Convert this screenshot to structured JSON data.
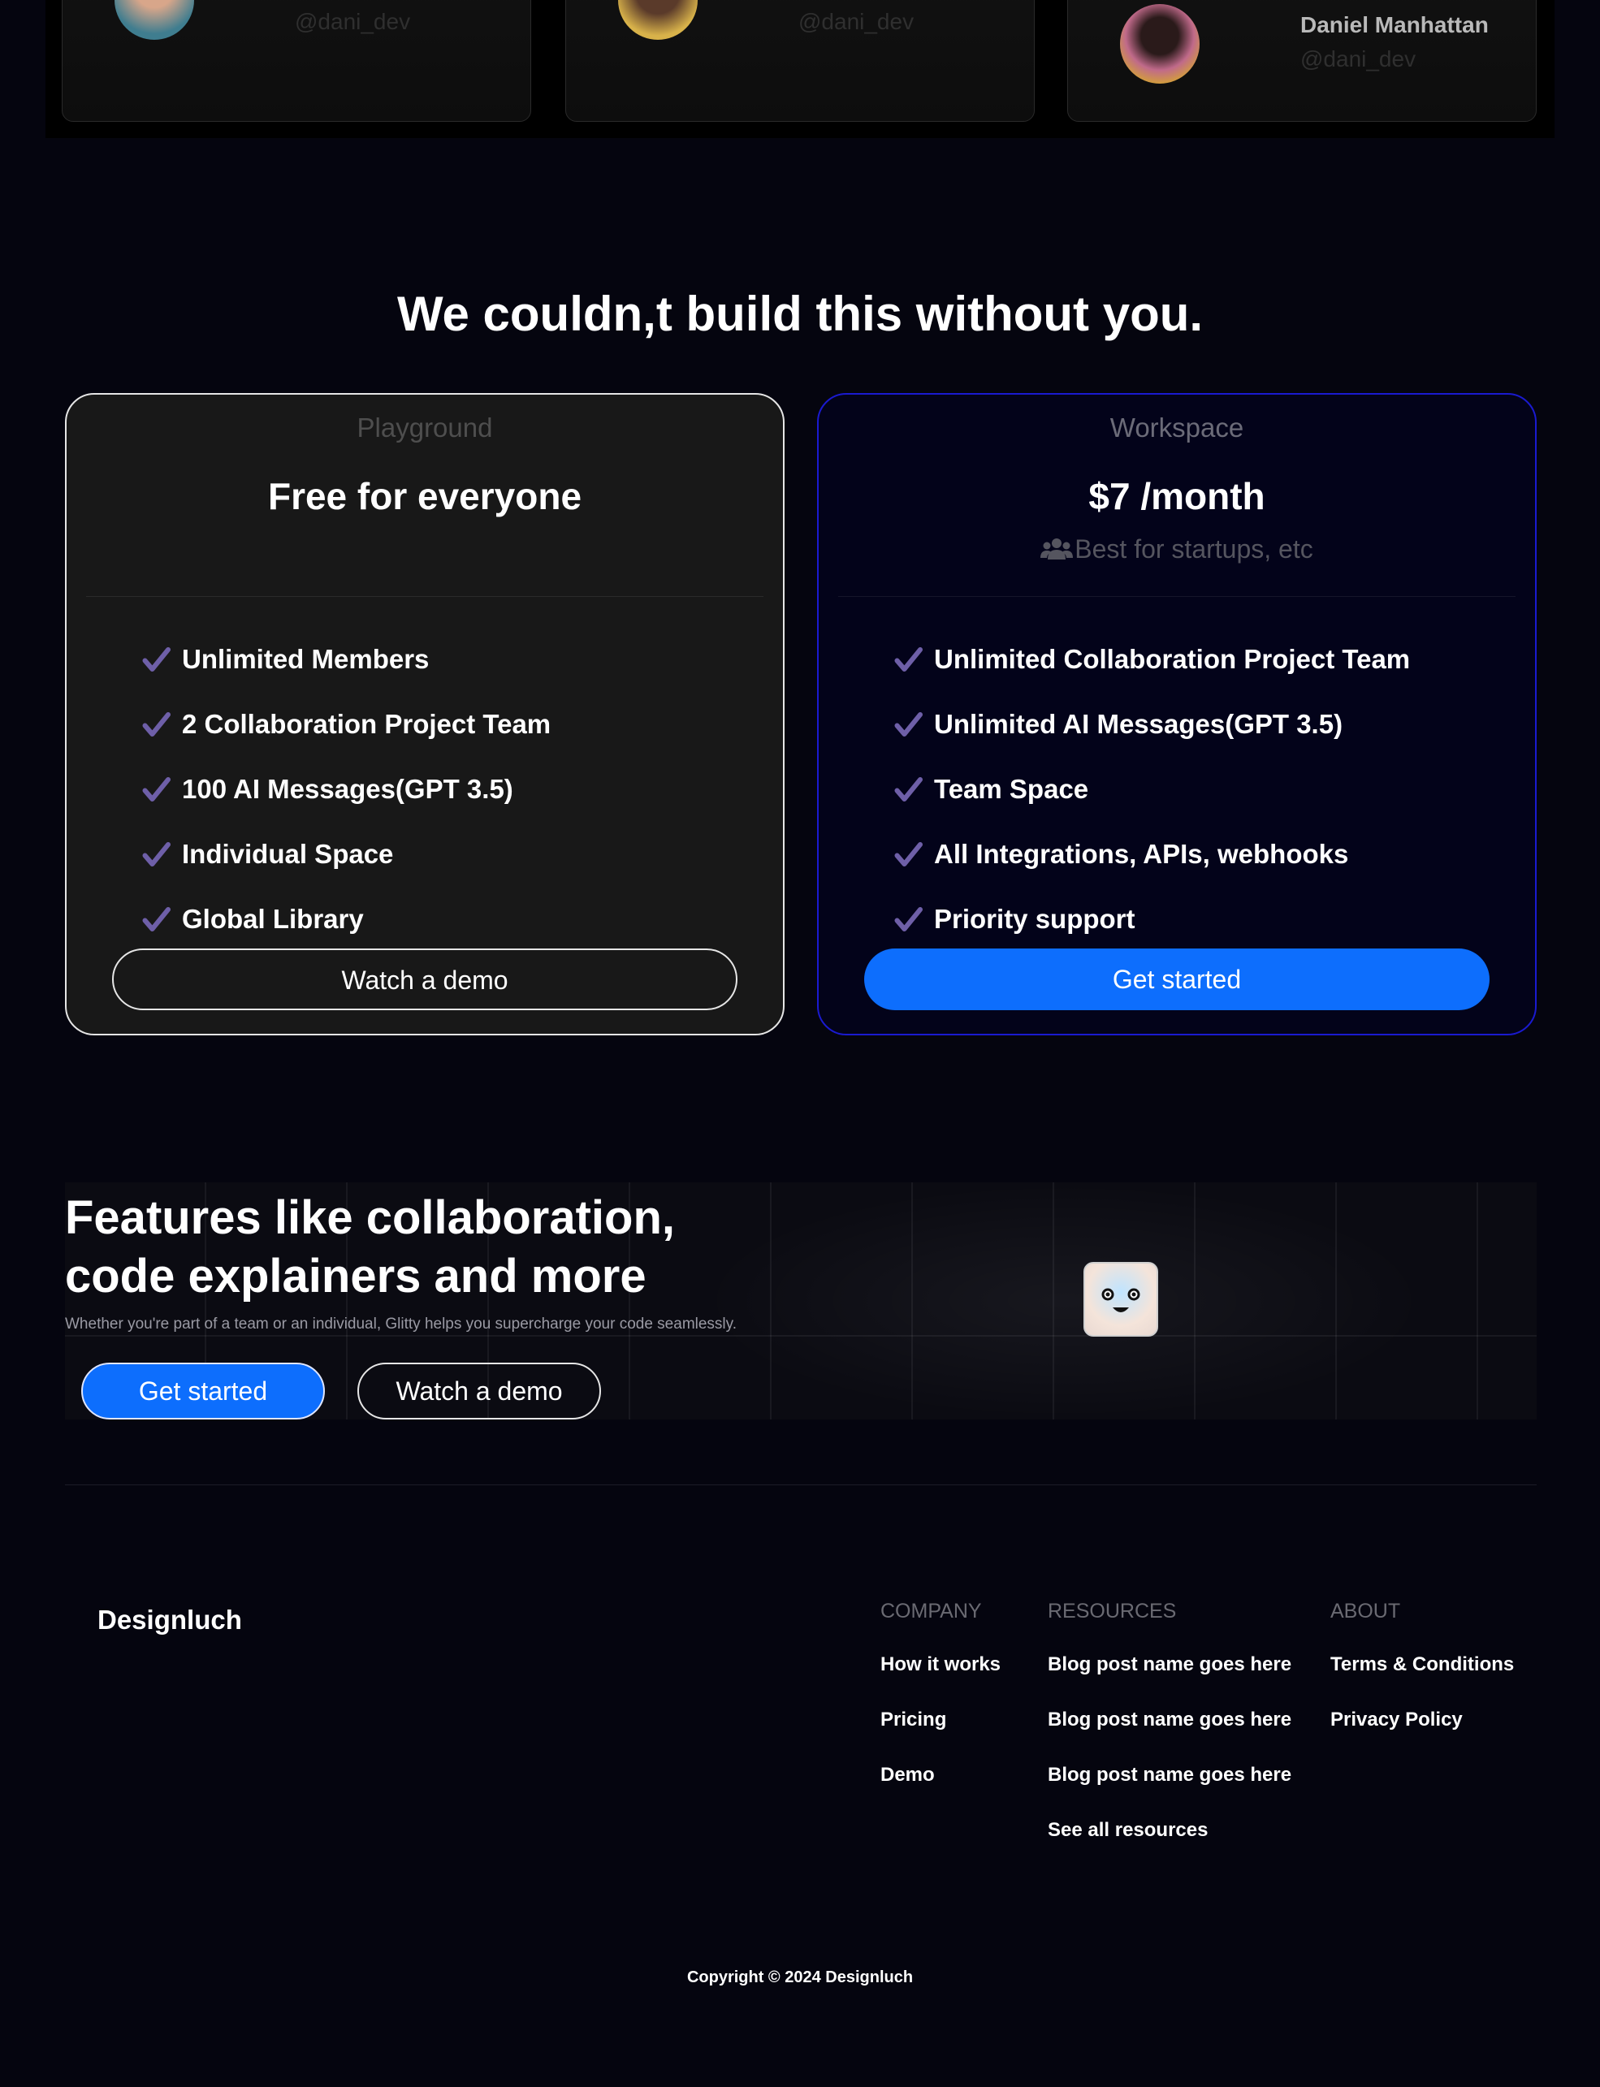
{
  "testimonials": [
    {
      "name": "",
      "handle": "@dani_dev"
    },
    {
      "name": "",
      "handle": "@dani_dev"
    },
    {
      "name": "Daniel Manhattan",
      "handle": "@dani_dev"
    }
  ],
  "pricing": {
    "title": "We couldn,t build this without you.",
    "plans": [
      {
        "name": "Playground",
        "price": "Free for everyone",
        "subtitle": "",
        "features": [
          "Unlimited Members",
          "2 Collaboration Project Team",
          "100 AI Messages(GPT 3.5)",
          "Individual Space",
          "Global Library"
        ],
        "cta": "Watch a demo"
      },
      {
        "name": "Workspace",
        "price": "$7 /month",
        "subtitle": "Best for startups, etc",
        "subtitle_icon": "users-icon",
        "features": [
          "Unlimited Collaboration Project Team",
          "Unlimited AI Messages(GPT 3.5)",
          "Team Space",
          "All Integrations, APIs, webhooks",
          "Priority support"
        ],
        "cta": "Get started"
      }
    ]
  },
  "banner": {
    "title_line1": "Features like collaboration,",
    "title_line2": "code explainers and more",
    "text": "Whether you're part of a team or an individual, Glitty helps you supercharge your code seamlessly.",
    "primary_cta": "Get started",
    "secondary_cta": "Watch a demo",
    "mascot_icon": "robot-face-icon"
  },
  "footer": {
    "brand": "Designluch",
    "columns": [
      {
        "heading": "COMPANY",
        "links": [
          "How it works",
          "Pricing",
          "Demo"
        ]
      },
      {
        "heading": "RESOURCES",
        "links": [
          "Blog post name goes here",
          "Blog post name goes here",
          "Blog post name goes here",
          "See all resources"
        ]
      },
      {
        "heading": "ABOUT",
        "links": [
          "Terms & Conditions",
          "Privacy Policy"
        ]
      }
    ],
    "copyright": "Copyright © 2024 Designluch"
  },
  "colors": {
    "background": "#05050f",
    "accent_blue": "#0d6efd",
    "check_purple": "#6e5fa8",
    "pro_border": "#1a1ad0"
  }
}
